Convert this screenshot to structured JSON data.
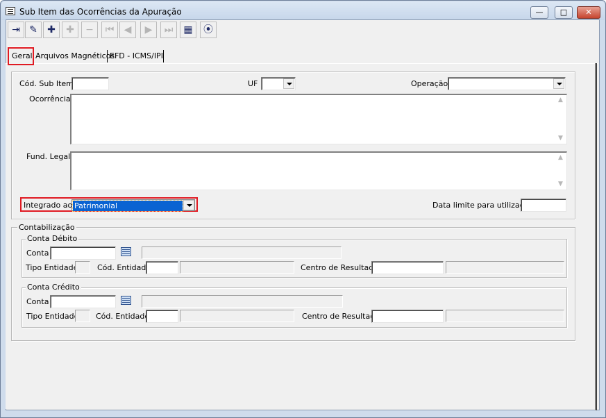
{
  "window": {
    "title": "Sub Item das Ocorrências da Apuração",
    "controls": {
      "minimize": "—",
      "maximize": "□",
      "close": "✕"
    }
  },
  "toolbar": {
    "buttons": [
      {
        "name": "exit-icon",
        "glyph": "⇥",
        "enabled": true
      },
      {
        "name": "edit-icon",
        "glyph": "✎",
        "enabled": true
      },
      {
        "name": "add-icon",
        "glyph": "✚",
        "enabled": true
      },
      {
        "name": "insert-icon",
        "glyph": "✚",
        "enabled": false
      },
      {
        "name": "remove-icon",
        "glyph": "−",
        "enabled": false
      },
      {
        "name": "first-record-icon",
        "glyph": "⏮",
        "enabled": false
      },
      {
        "name": "previous-record-icon",
        "glyph": "◀",
        "enabled": false
      },
      {
        "name": "next-record-icon",
        "glyph": "▶",
        "enabled": false
      },
      {
        "name": "last-record-icon",
        "glyph": "⏭",
        "enabled": false
      },
      {
        "name": "grid-view-icon",
        "glyph": "▦",
        "enabled": true
      },
      {
        "name": "find-icon",
        "glyph": "⦿",
        "enabled": true
      }
    ]
  },
  "tabs": [
    {
      "label": "Geral",
      "active": true
    },
    {
      "label": "Arquivos Magnéticos",
      "active": false
    },
    {
      "label": "EFD - ICMS/IPI",
      "active": false
    }
  ],
  "general": {
    "cod_sub_item_label": "Cód. Sub Item",
    "cod_sub_item_value": "",
    "uf_label": "UF",
    "uf_value": "",
    "operacao_label": "Operação",
    "operacao_value": "",
    "ocorrencia_label": "Ocorrência",
    "ocorrencia_value": "",
    "fund_legal_label": "Fund. Legal",
    "fund_legal_value": "",
    "integrado_label": "Integrado ao",
    "integrado_value": "Patrimonial",
    "data_limite_label": "Data limite para utilização:",
    "data_limite_value": ""
  },
  "contabilizacao": {
    "title": "Contabilização",
    "debito": {
      "title": "Conta Débito",
      "conta_label": "Conta",
      "tipo_entidade_label": "Tipo Entidade",
      "cod_entidade_label": "Cód. Entidade",
      "centro_resultado_label": "Centro de Resultado"
    },
    "credito": {
      "title": "Conta Crédito",
      "conta_label": "Conta",
      "tipo_entidade_label": "Tipo Entidade",
      "cod_entidade_label": "Cód. Entidade",
      "centro_resultado_label": "Centro de Resultado"
    }
  },
  "colors": {
    "selection": "#0a63d2",
    "highlight_box": "#e01a22",
    "frame": "#cfdcec"
  }
}
